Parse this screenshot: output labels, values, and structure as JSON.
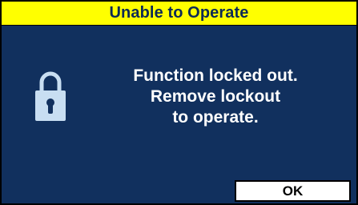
{
  "dialog": {
    "title": "Unable to Operate",
    "icon": "lock-icon",
    "message_lines": [
      "Function locked out.",
      "Remove lockout",
      "to operate."
    ],
    "ok_label": "OK"
  },
  "colors": {
    "title_bar": "#ffff00",
    "title_text": "#0b2a56",
    "background": "#11305e",
    "message_text": "#ffffff",
    "icon": "#c8def2",
    "button_background": "#ffffff",
    "button_text": "#000000"
  }
}
